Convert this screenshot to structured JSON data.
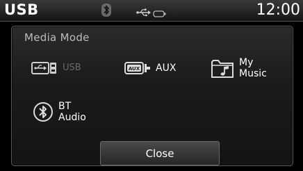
{
  "status": {
    "source": "USB",
    "clock": "12:00",
    "icons": [
      "bluetooth-icon",
      "usb-icon",
      "battery-icon"
    ]
  },
  "popup": {
    "title": "Media Mode",
    "items": [
      {
        "label": "USB",
        "icon": "usb-port-icon",
        "state": "disabled"
      },
      {
        "label": "AUX",
        "icon": "aux-port-icon",
        "state": "enabled"
      },
      {
        "label": "My\nMusic",
        "icon": "folder-music-icon",
        "state": "enabled"
      },
      {
        "label": "BT\nAudio",
        "icon": "bluetooth-icon",
        "state": "enabled"
      }
    ],
    "close_label": "Close"
  },
  "colors": {
    "background": "#000000",
    "panel": "#1b1b1b",
    "border": "#5b5b5b",
    "disabled_text": "#6a6a6a",
    "text": "#ffffff"
  }
}
